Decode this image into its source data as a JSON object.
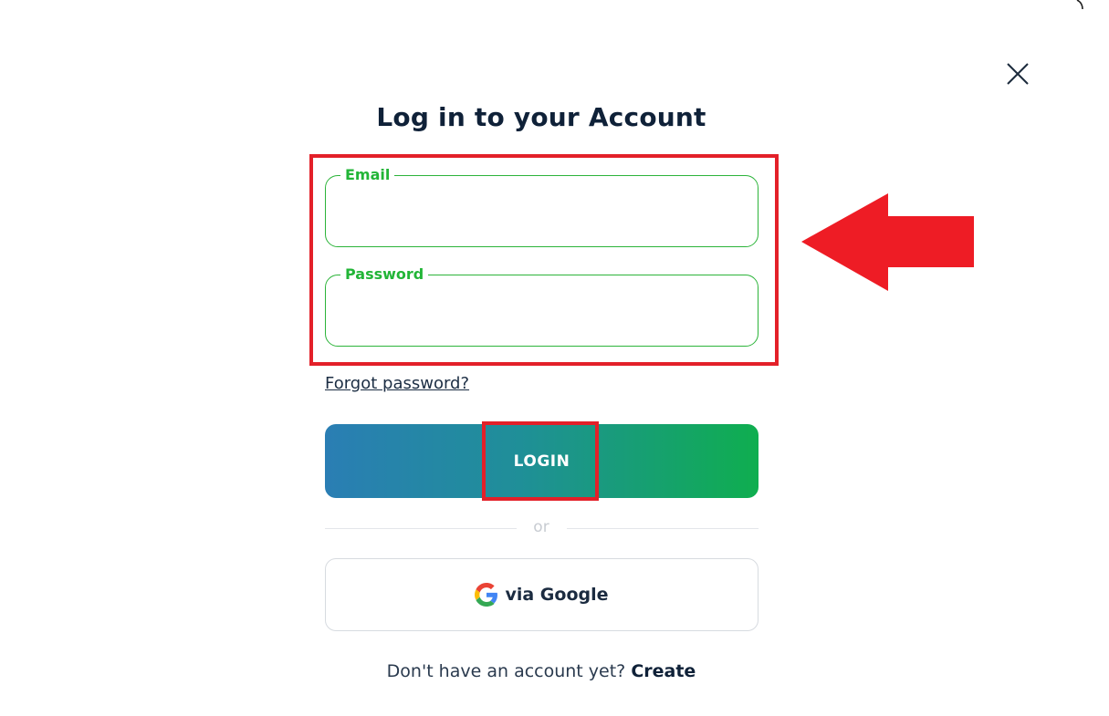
{
  "dialog": {
    "title": "Log in to your Account",
    "close_icon": "close-icon"
  },
  "form": {
    "email": {
      "label": "Email",
      "value": ""
    },
    "password": {
      "label": "Password",
      "value": ""
    },
    "forgot_password": "Forgot password?",
    "login_label": "LOGIN",
    "divider": "or",
    "google": {
      "icon": "google-icon",
      "label": "via Google"
    },
    "signup_prompt": "Don't have an account yet?",
    "signup_link": "Create"
  },
  "colors": {
    "accent_green": "#22b537",
    "annotation_red": "#e32029",
    "title_dark": "#0f2138",
    "button_gradient_start": "#2a7eb4",
    "button_gradient_end": "#0fae4f"
  },
  "annotations": {
    "arrow_icon": "arrow-left-icon"
  }
}
